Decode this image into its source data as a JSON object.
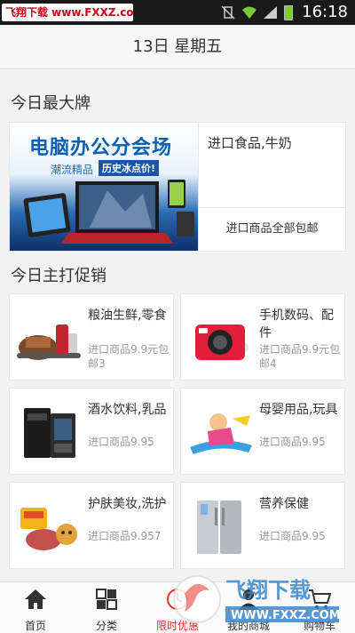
{
  "statusbar": {
    "watermark": "飞翔下载 www.FXXZ.com",
    "time": "16:18",
    "battery_color": "#7ec83a"
  },
  "header": {
    "date": "13日 星期五"
  },
  "sections": {
    "top_brand": "今日最大牌",
    "promo": "今日主打促销"
  },
  "brand": {
    "banner_title": "电脑办公分会场",
    "banner_sub1": "潮流精品",
    "banner_sub2": "历史冰点价!",
    "right_top": "进口食品,牛奶",
    "right_bottom": "进口商品全部包邮"
  },
  "promo_cards": [
    {
      "title": "粮油生鲜,零食",
      "subtitle": "进口商品9.9元包邮3",
      "icon": "kitchen-appliances-icon"
    },
    {
      "title": "手机数码、配件",
      "subtitle": "进口商品9.9元包邮4",
      "icon": "camera-icon"
    },
    {
      "title": "酒水饮料,乳品",
      "subtitle": "进口商品9.95",
      "icon": "pc-tower-icon"
    },
    {
      "title": "母婴用品,玩具",
      "subtitle": "进口商品9.95",
      "icon": "kids-toy-icon"
    },
    {
      "title": "护肤美妆,洗护",
      "subtitle": "进口商品9.957",
      "icon": "snack-food-icon"
    },
    {
      "title": "营养保健",
      "subtitle": "进口商品9.95",
      "icon": "refrigerator-icon"
    }
  ],
  "bottomnav": [
    {
      "label": "首页",
      "icon": "home-icon"
    },
    {
      "label": "分类",
      "icon": "grid-icon"
    },
    {
      "label": "限时优惠",
      "icon": "clock-icon",
      "active": true
    },
    {
      "label": "我的商城",
      "icon": "user-icon"
    },
    {
      "label": "购物车",
      "icon": "cart-icon"
    }
  ],
  "watermark_logo": "飞翔下载 WWW.FXXZ.COM",
  "accent_color": "#e8322a"
}
